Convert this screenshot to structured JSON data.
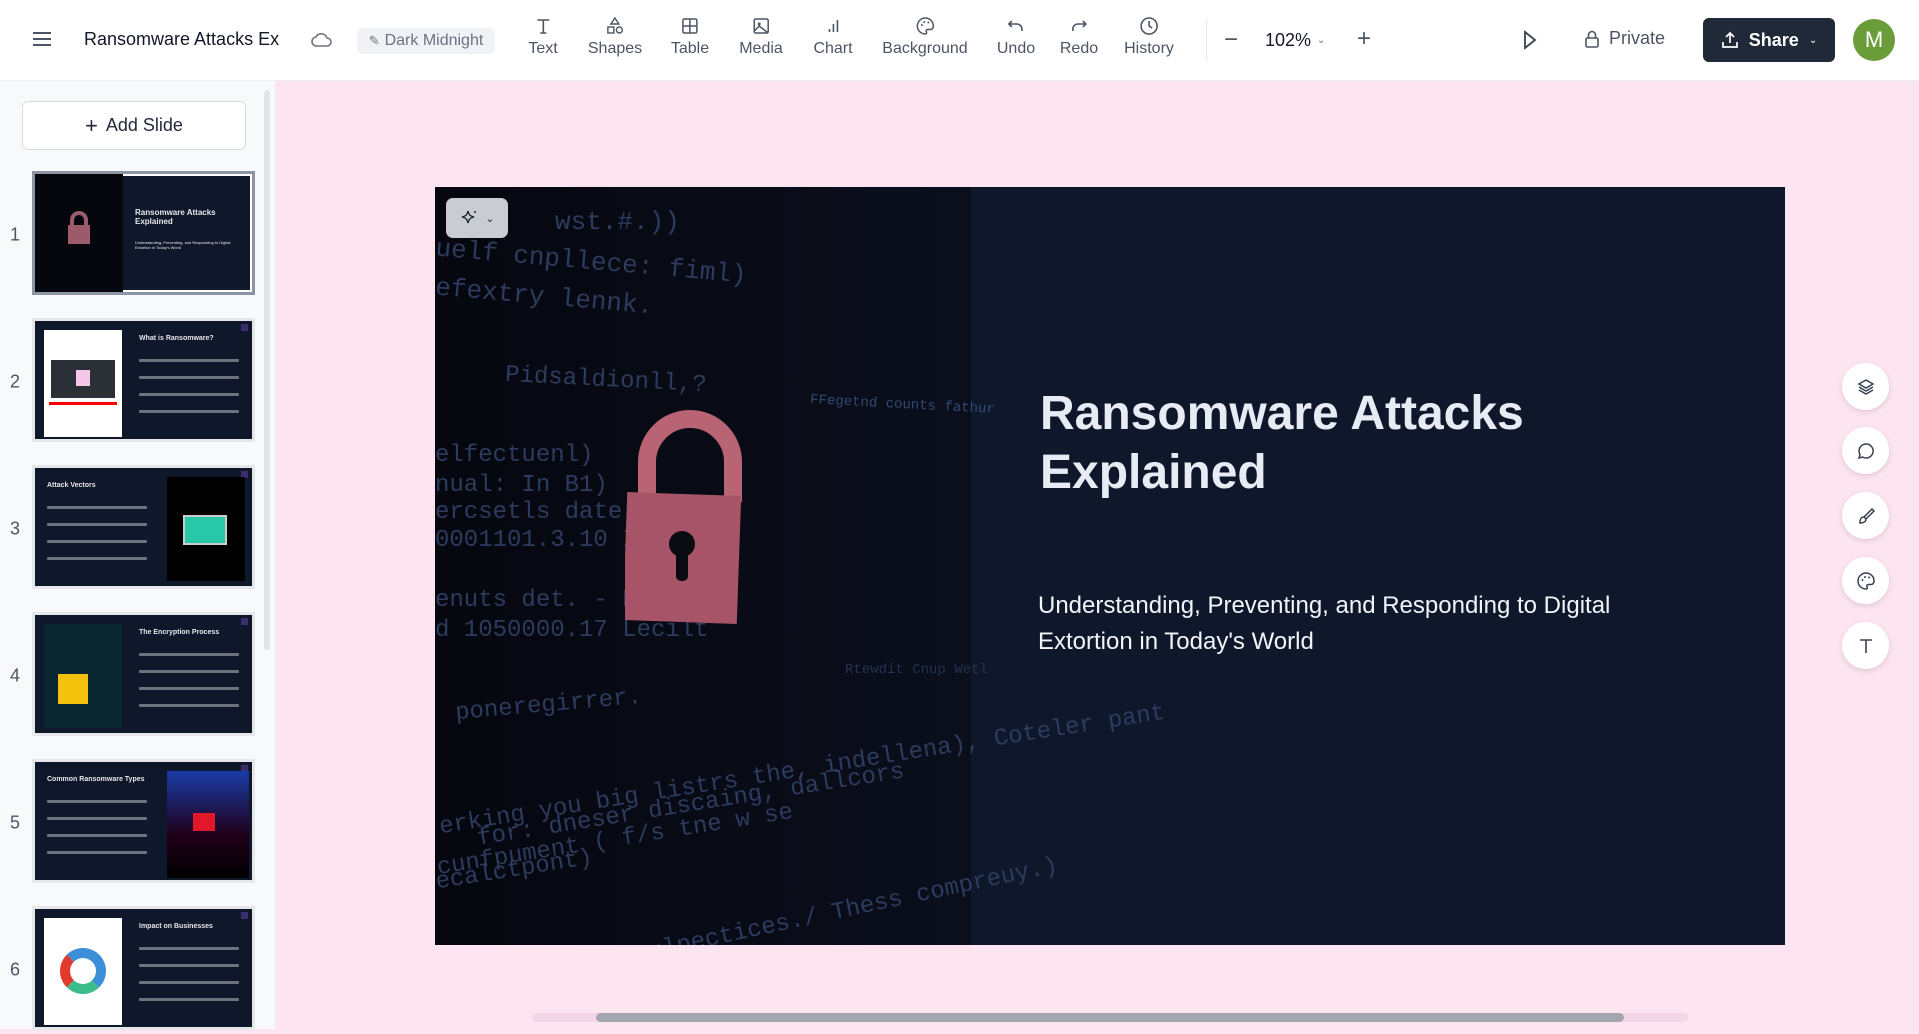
{
  "header": {
    "doc_title": "Ransomware Attacks Ex",
    "theme_label": "Dark Midnight",
    "tools": [
      {
        "label": "Text",
        "icon": "text-icon"
      },
      {
        "label": "Shapes",
        "icon": "shapes-icon"
      },
      {
        "label": "Table",
        "icon": "table-icon"
      },
      {
        "label": "Media",
        "icon": "image-icon"
      },
      {
        "label": "Chart",
        "icon": "chart-icon"
      },
      {
        "label": "Background",
        "icon": "palette-icon"
      },
      {
        "label": "Undo",
        "icon": "undo-icon"
      },
      {
        "label": "Redo",
        "icon": "redo-icon"
      },
      {
        "label": "History",
        "icon": "clock-icon"
      }
    ],
    "zoom": "102%",
    "privacy_label": "Private",
    "share_label": "Share",
    "avatar_initial": "M",
    "avatar_color": "#6a9c3a",
    "share_bg": "#1f2937"
  },
  "sidebar": {
    "add_slide_label": "Add Slide",
    "slides": [
      {
        "number": "1",
        "title": "Ransomware Attacks Explained",
        "subtitle": "Understanding, Preventing, and Responding to Digital Extortion in Today's World"
      },
      {
        "number": "2",
        "title": "What is Ransomware?"
      },
      {
        "number": "3",
        "title": "Attack Vectors"
      },
      {
        "number": "4",
        "title": "The Encryption Process"
      },
      {
        "number": "5",
        "title": "Common Ransomware Types"
      },
      {
        "number": "6",
        "title": "Impact on Businesses"
      }
    ]
  },
  "slide": {
    "title": "Ransomware Attacks Explained",
    "subtitle": "Understanding, Preventing, and Responding to Digital Extortion in Today's World",
    "background": "#0f172a"
  },
  "canvas": {
    "background": "#fde4f1"
  }
}
